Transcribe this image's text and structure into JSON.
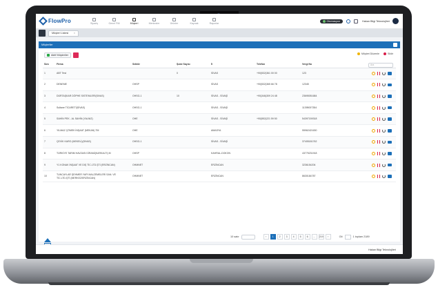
{
  "app": {
    "logo": "FlowPro",
    "user": "Hakan Bilgi Teknolojileri",
    "status": "Otomasyon"
  },
  "modules": [
    {
      "label": "Sipariş",
      "active": false
    },
    {
      "label": "Genel Fiili",
      "active": false
    },
    {
      "label": "Müşteri",
      "active": true
    },
    {
      "label": "Merkezler",
      "active": false
    },
    {
      "label": "Ürünler",
      "active": false
    },
    {
      "label": "Kaynak",
      "active": false
    },
    {
      "label": "Raporlar",
      "active": false
    }
  ],
  "tab": {
    "label": "Müşteri Listesi",
    "close": "×"
  },
  "panel": {
    "title": "Müşteriler"
  },
  "toolbar": {
    "active_label": "Aktif Müşteriler"
  },
  "legend": {
    "edit": "Müşteri Düzenle",
    "delete": "Sildir"
  },
  "search": {
    "placeholder": "Ara"
  },
  "table": {
    "headers": [
      "Sıra",
      "Firma",
      "Sektör",
      "Şube Sayısı",
      "İl",
      "Telefon",
      "Vergi No",
      ""
    ],
    "rows": [
      [
        "1",
        "ABT Test",
        "",
        "0",
        "SİVAS",
        "+90(532)361 00 00",
        "123"
      ],
      [
        "2",
        "DENEME",
        "OHSP",
        "",
        "SİVAS",
        "+90(532)365 66 78",
        "12345"
      ],
      [
        "3",
        "DÜRTAŞKAR DÖPHE SISTEMLERİ(SIVAS)",
        "OHSG-1",
        "10",
        "SİVAS - SİVAŞİ",
        "+90(346)309 24 48",
        "23695051684"
      ],
      [
        "4",
        "Sultane TİCARETİ(SİVAS)",
        "OHSG-1",
        "",
        "SİVAS - SİVAŞİ",
        "",
        "11395007354"
      ],
      [
        "5",
        "SAHİN PEK - AL SAHİN (YALNIZ)",
        "OHE",
        "",
        "SİVAS - SİVAŞİ",
        "+90(552)221 59 50",
        "54397159318"
      ],
      [
        "6",
        "YILMAZ ÇÖMEK İNŞAAT (MEKAN) TM",
        "OHE",
        "",
        "AMASYA",
        "",
        "55962421630"
      ],
      [
        "7",
        "ÇEVİK KARO (MEKELİ)(SIVAS)",
        "OHSG-1",
        "",
        "SİVAS - SİVAŞİ",
        "",
        "37405181762"
      ],
      [
        "8",
        "TÜRKİYE TARIM HAVZASI DİRAMİ(KARKALTI) M",
        "OHSP",
        "",
        "KAHRAL-DOKON",
        "",
        "43775231918"
      ],
      [
        "9",
        "Y1 KONAK İNŞAAT VE DIŞ TİC.LTD.ŞTİ (ERZİNCAN)",
        "OHMNET",
        "",
        "ERZİNCAN",
        "",
        "3236154204"
      ],
      [
        "10",
        "TUNCAYLAR ŞEHMER YAPI MALZEMELERİ SAN. VE TİC.LTD.ŞTİ (MERKEZ/ERZİNCAN)",
        "OHMNET",
        "",
        "ERZİNCAN",
        "",
        "8630184787"
      ]
    ]
  },
  "pagination": {
    "per_page_label": "10 satır",
    "pages": [
      "‹",
      "1",
      "2",
      "3",
      "4",
      "5",
      "6",
      "...",
      "219",
      "›"
    ],
    "goto_label": "Git",
    "total": "1 toplam 2189"
  },
  "footer": {
    "text": "Hakan Bilgi Teknolojileri"
  }
}
